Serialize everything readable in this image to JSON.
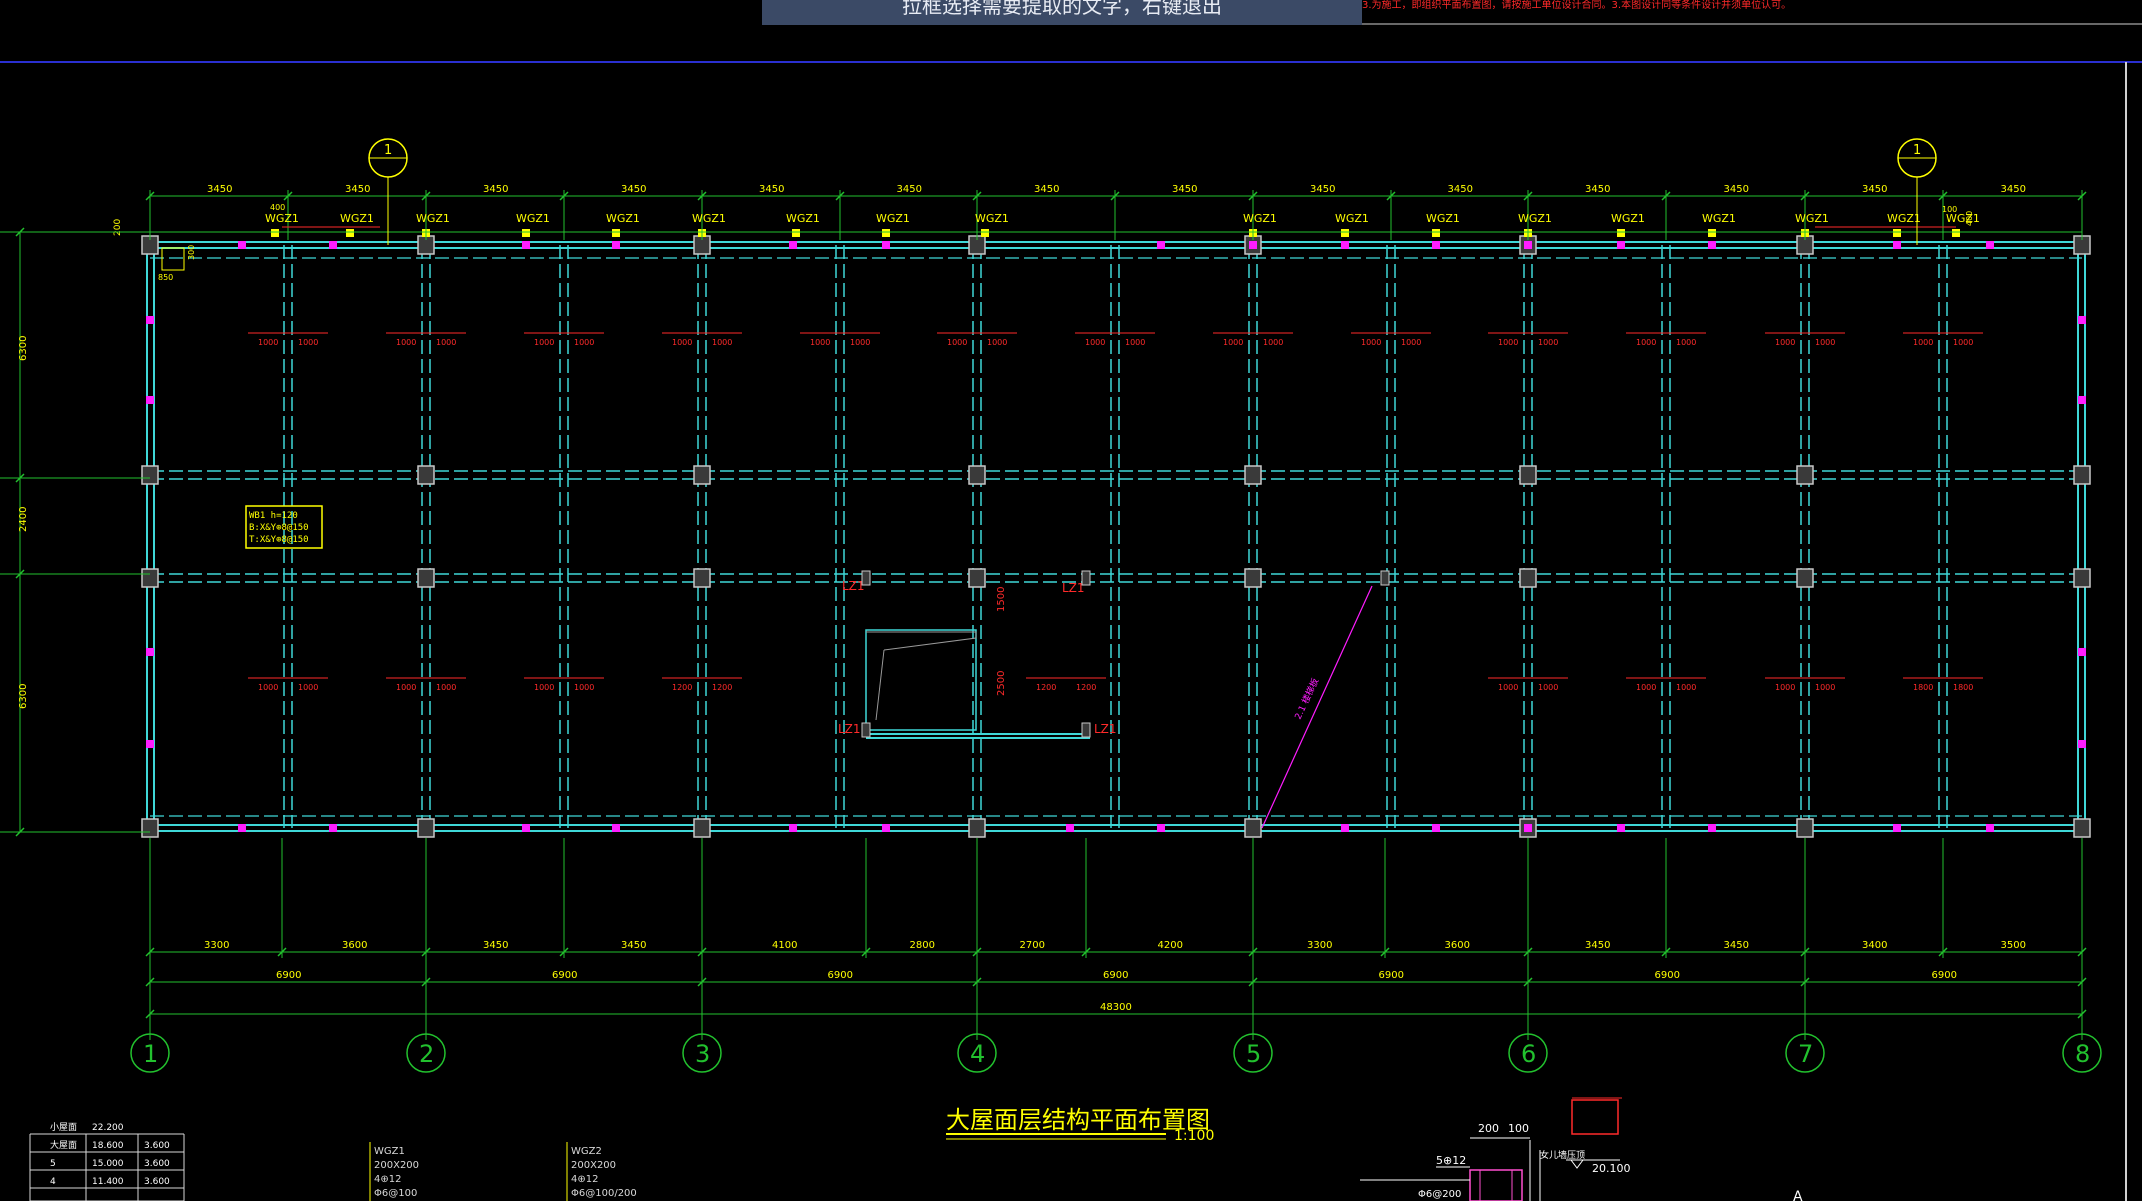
{
  "prompt_text": "拉框选择需要提取的文字，右键退出",
  "top_note": "3.为施工，即组织平面布置图，请按施工单位设计合同。3.本图设计同等条件设计并须单位认可。",
  "drawing": {
    "title": "大屋面层结构平面布置图",
    "scale": "1:100",
    "axes": [
      "1",
      "2",
      "3",
      "4",
      "5",
      "6",
      "7",
      "8"
    ],
    "top_dims": [
      "3450",
      "3450",
      "3450",
      "3450",
      "3450",
      "3450",
      "3450",
      "3450",
      "3450",
      "3450",
      "3450",
      "3450",
      "3450",
      "3450"
    ],
    "bottom_dims_row1": [
      "3300",
      "3600",
      "3450",
      "3450",
      "4100",
      "2800",
      "2700",
      "4200",
      "3300",
      "3600",
      "3450",
      "3450",
      "3400",
      "3500"
    ],
    "bottom_dims_row2": [
      "6900",
      "6900",
      "6900",
      "6900",
      "6900",
      "6900",
      "6900"
    ],
    "total_dim": "48300",
    "left_dims": [
      "6300",
      "2400",
      "6300"
    ],
    "edge_dim": "200",
    "detail_dims": [
      "400",
      "850",
      "300",
      "100",
      "400"
    ],
    "column_label": "WGZ1",
    "lz_label": "LZ1",
    "section_mark": "1",
    "slab_note": [
      "WB1 h=120",
      "B:X&Y⊕8@150",
      "T:X&Y⊕8@150"
    ],
    "rebar_top": [
      "1000",
      "1000",
      "1000",
      "1000",
      "1000",
      "1000",
      "1000",
      "1000",
      "1000",
      "1000",
      "1000",
      "1000",
      "1000",
      "1000",
      "1000",
      "1000",
      "1000",
      "1000",
      "1000",
      "1000",
      "1000",
      "1000",
      "1000",
      "1000",
      "1000",
      "1000"
    ],
    "rebar_bottom": [
      "1000",
      "1000",
      "1000",
      "1000",
      "1000",
      "1000",
      "1200",
      "1200",
      "1200",
      "1200",
      "1000",
      "1000",
      "1000",
      "1000",
      "1000",
      "1000",
      "1800",
      "1800"
    ],
    "stair_dims": [
      "1500",
      "2500"
    ],
    "diag_text": "2.1 楼梯板"
  },
  "level_table": {
    "rows": [
      [
        "小屋面",
        "22.200",
        ""
      ],
      [
        "大屋面",
        "18.600",
        "3.600"
      ],
      [
        "5",
        "15.000",
        "3.600"
      ],
      [
        "4",
        "11.400",
        "3.600"
      ]
    ]
  },
  "wgz1": [
    "WGZ1",
    "200X200",
    "4⊕12",
    "Φ6@100"
  ],
  "wgz2": [
    "WGZ2",
    "200X200",
    "4⊕12",
    "Φ6@100/200"
  ],
  "detail": {
    "dims": [
      "200",
      "100"
    ],
    "bar": "5⊕12",
    "elev": "20.100",
    "label": "女儿墙压顶",
    "stirrup": "Φ6@200",
    "mark": "A"
  }
}
